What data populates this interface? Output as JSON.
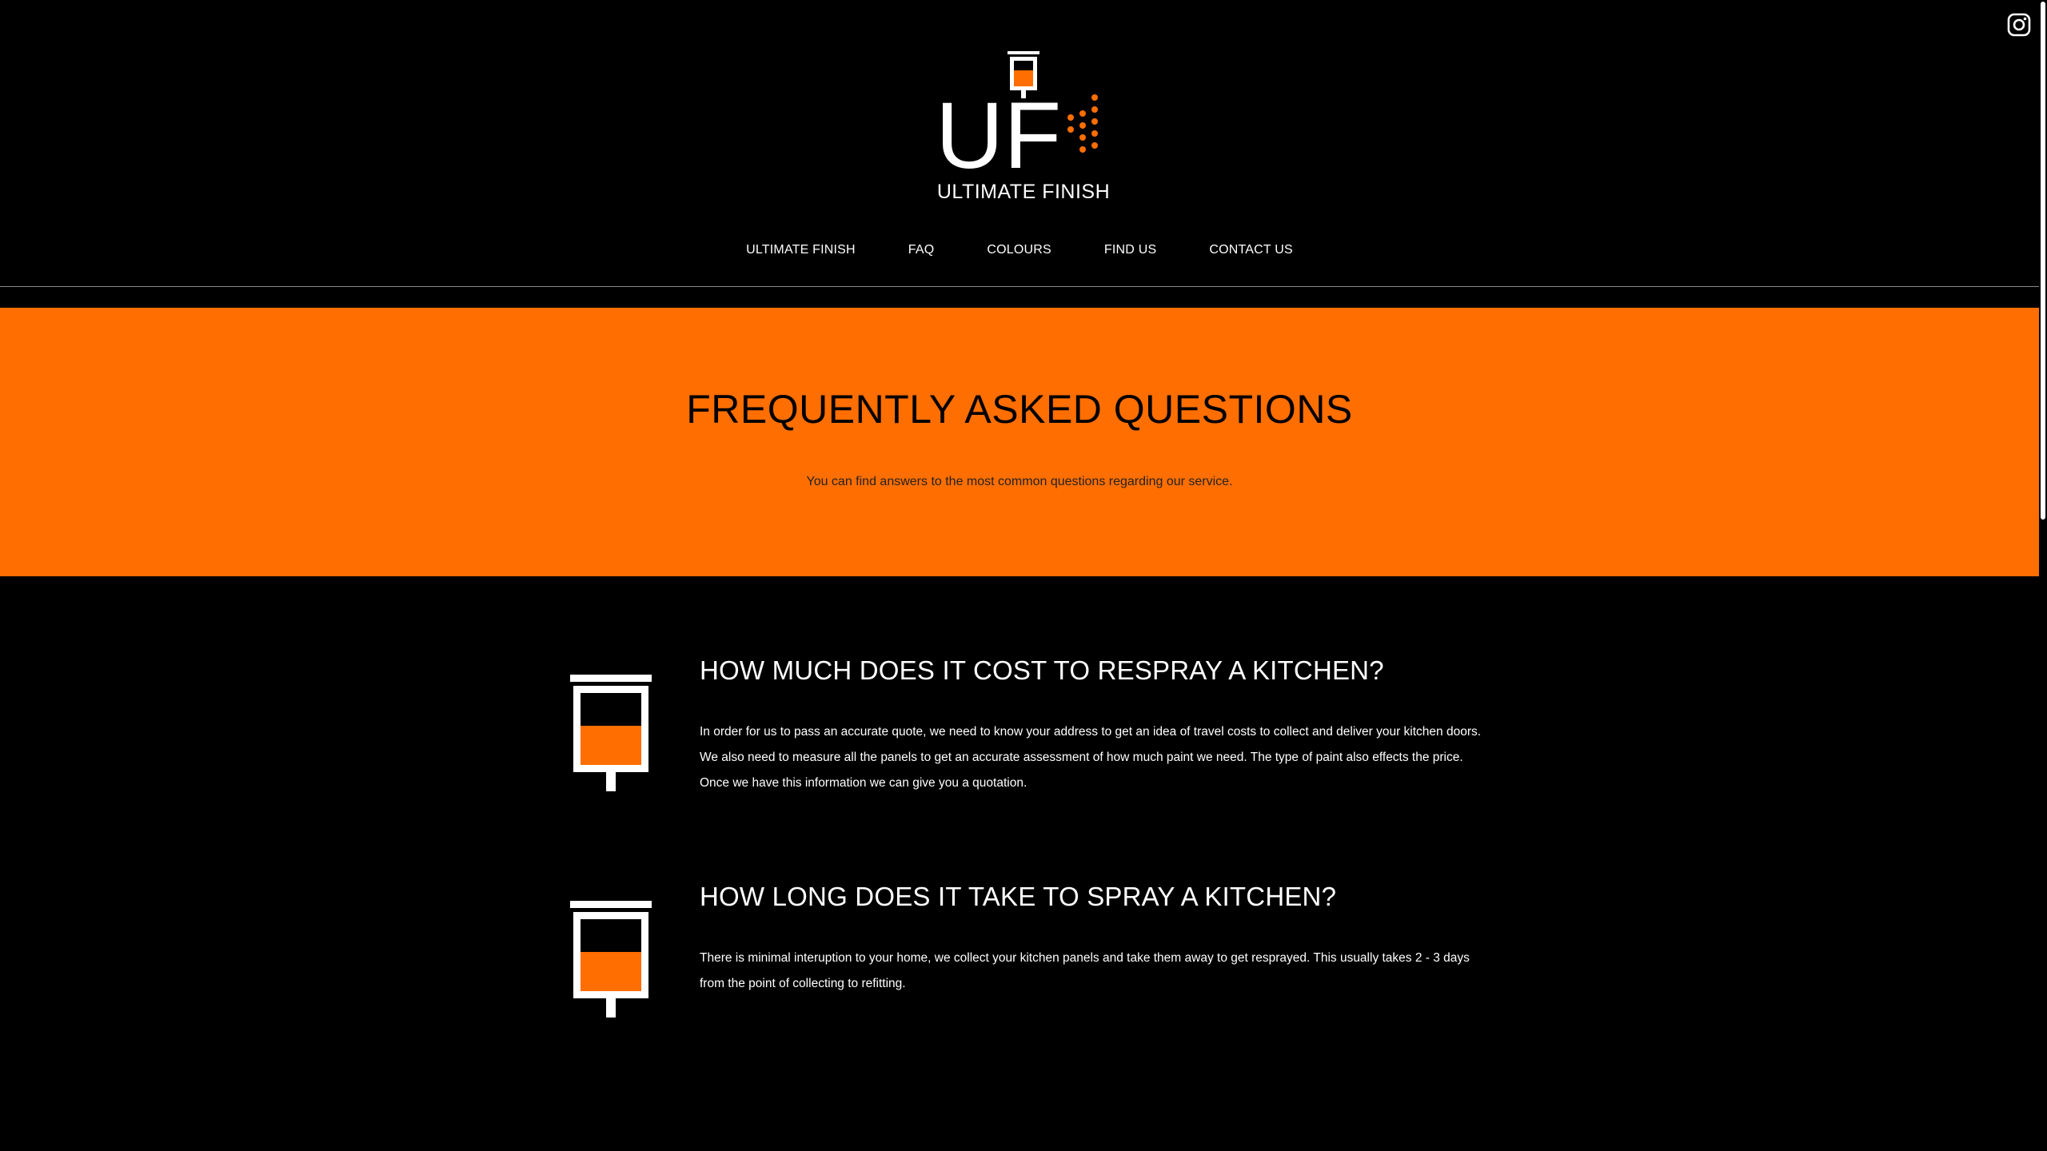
{
  "brand": {
    "logo_letters": "UF",
    "name": "ULTIMATE FINISH",
    "accent_color": "#ff6e00"
  },
  "social": {
    "icon": "instagram-icon"
  },
  "nav": {
    "items": [
      {
        "label": "ULTIMATE FINISH"
      },
      {
        "label": "FAQ"
      },
      {
        "label": "COLOURS"
      },
      {
        "label": "FIND US"
      },
      {
        "label": "CONTACT US"
      }
    ]
  },
  "hero": {
    "title": "FREQUENTLY ASKED QUESTIONS",
    "subtitle": "You can find answers to the most common questions regarding our service."
  },
  "faq": [
    {
      "icon": "paint-roller-icon",
      "question": "HOW MUCH DOES IT COST TO RESPRAY A KITCHEN?",
      "answer": "In order for us to pass an accurate quote, we need to know your address to get an idea of travel costs to collect and deliver your kitchen doors. We also need to measure all the panels to get an accurate assessment of how much paint we need. The type of paint also effects the price. Once we have this information we can give you a quotation."
    },
    {
      "icon": "paint-roller-icon",
      "question": "HOW LONG DOES IT TAKE TO SPRAY A KITCHEN?",
      "answer": "There is minimal interuption to your home, we collect your kitchen panels and take them away to get resprayed. This usually takes 2 - 3 days from the point of collecting to refitting."
    }
  ]
}
